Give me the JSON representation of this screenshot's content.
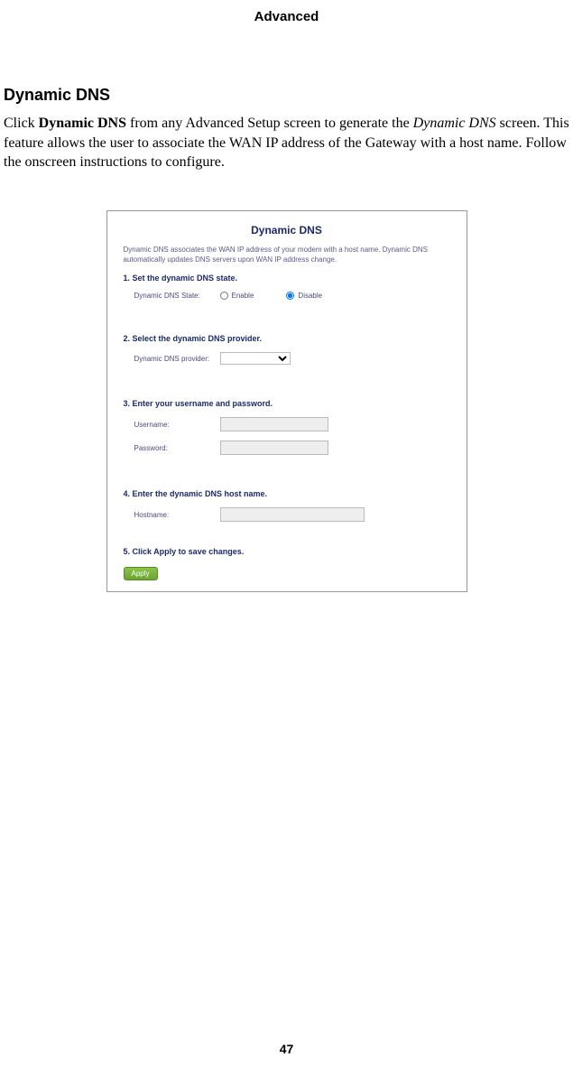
{
  "header": {
    "title": "Advanced"
  },
  "page": {
    "heading": "Dynamic DNS",
    "paragraph_parts": {
      "p1": "Click ",
      "p2_bold": "Dynamic DNS",
      "p3": " from any Advanced Setup screen to generate the ",
      "p4_italic": "Dynamic DNS",
      "p5": " screen. This feature allows the user to associate the WAN IP address of the Gateway with a host name. Follow the onscreen instructions to configure."
    }
  },
  "screenshot": {
    "title": "Dynamic DNS",
    "description": "Dynamic DNS associates the WAN IP address of your modem with a host name. Dynamic DNS automatically updates DNS servers upon WAN IP address change.",
    "step1": {
      "heading": "1. Set the dynamic DNS state.",
      "label": "Dynamic DNS State:",
      "enable": "Enable",
      "disable": "Disable"
    },
    "step2": {
      "heading": "2. Select the dynamic DNS provider.",
      "label": "Dynamic DNS provider:"
    },
    "step3": {
      "heading": "3. Enter your username and password.",
      "username_label": "Username:",
      "password_label": "Password:"
    },
    "step4": {
      "heading": "4. Enter the dynamic DNS host name.",
      "hostname_label": "Hostname:"
    },
    "step5": {
      "heading": "5. Click Apply to save changes.",
      "button": "Apply"
    }
  },
  "footer": {
    "page_number": "47"
  }
}
